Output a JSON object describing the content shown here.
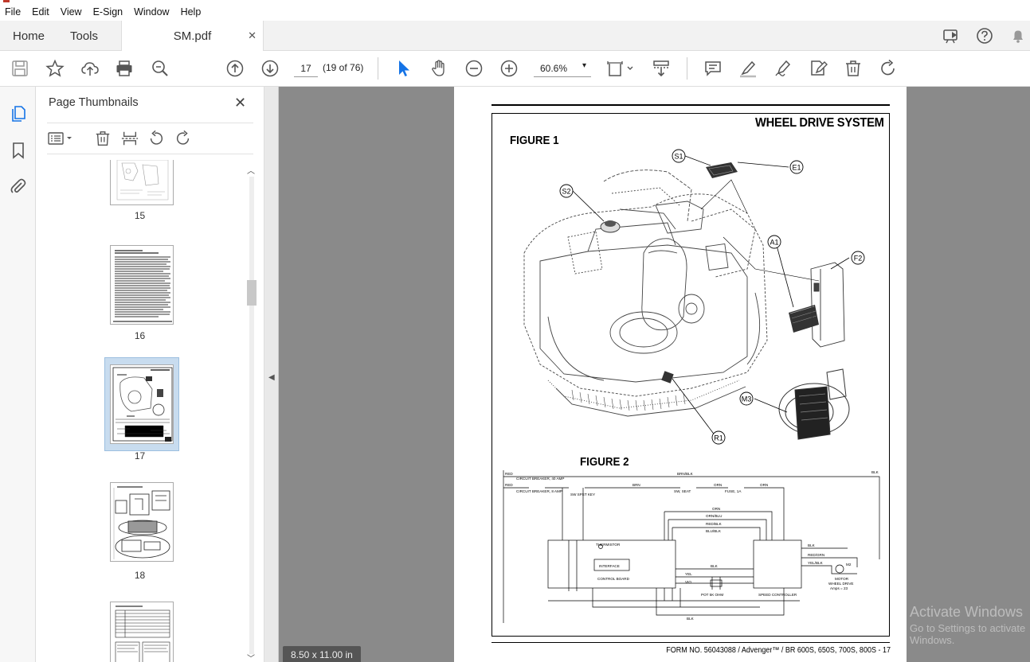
{
  "menubar": {
    "items": [
      "File",
      "Edit",
      "View",
      "E-Sign",
      "Window",
      "Help"
    ]
  },
  "tabs": {
    "home": "Home",
    "tools": "Tools",
    "document": "SM.pdf",
    "close_glyph": "✕"
  },
  "toolbar": {
    "page_number": "17",
    "page_count": "(19 of 76)",
    "zoom": "60.6%",
    "zoom_caret": "▾"
  },
  "thumbnails_panel": {
    "title": "Page Thumbnails",
    "close_glyph": "✕",
    "pages": [
      {
        "label": "15"
      },
      {
        "label": "16"
      },
      {
        "label": "17",
        "selected": true
      },
      {
        "label": "18"
      },
      {
        "label": ""
      }
    ]
  },
  "document": {
    "page_size": "8.50 x 11.00 in",
    "title": "WHEEL DRIVE SYSTEM",
    "figure1_label": "FIGURE 1",
    "figure2_label": "FIGURE 2",
    "callouts": [
      "S1",
      "E1",
      "S2",
      "A1",
      "F2",
      "M3",
      "R1"
    ],
    "footer": "FORM NO. 56043088 / Advenger™ / BR 600S, 650S, 700S, 800S - 17",
    "schematic": {
      "circuit_breaker_1": "CIRCUIT BREAKER, 40 AMP",
      "circuit_breaker_2": "CIRCUIT BREAKER, 8 AMP",
      "control_board": "CONTROL BOARD",
      "interface": "INTERFACE",
      "speed_controller": "SPEED CONTROLLER",
      "pot": "POT 5K OHM",
      "motor": "MOTOR",
      "wheel_drive": "WHEEL DRIVE",
      "amps": "Amps = 23",
      "fuse": "FUSE, 1A",
      "sw_seat": "SW, SEAT",
      "sw_key": "SW SPST KEY",
      "thermistor": "THERMISTOR"
    }
  },
  "watermark": {
    "line1": "Activate Windows",
    "line2": "Go to Settings to activate Windows."
  }
}
